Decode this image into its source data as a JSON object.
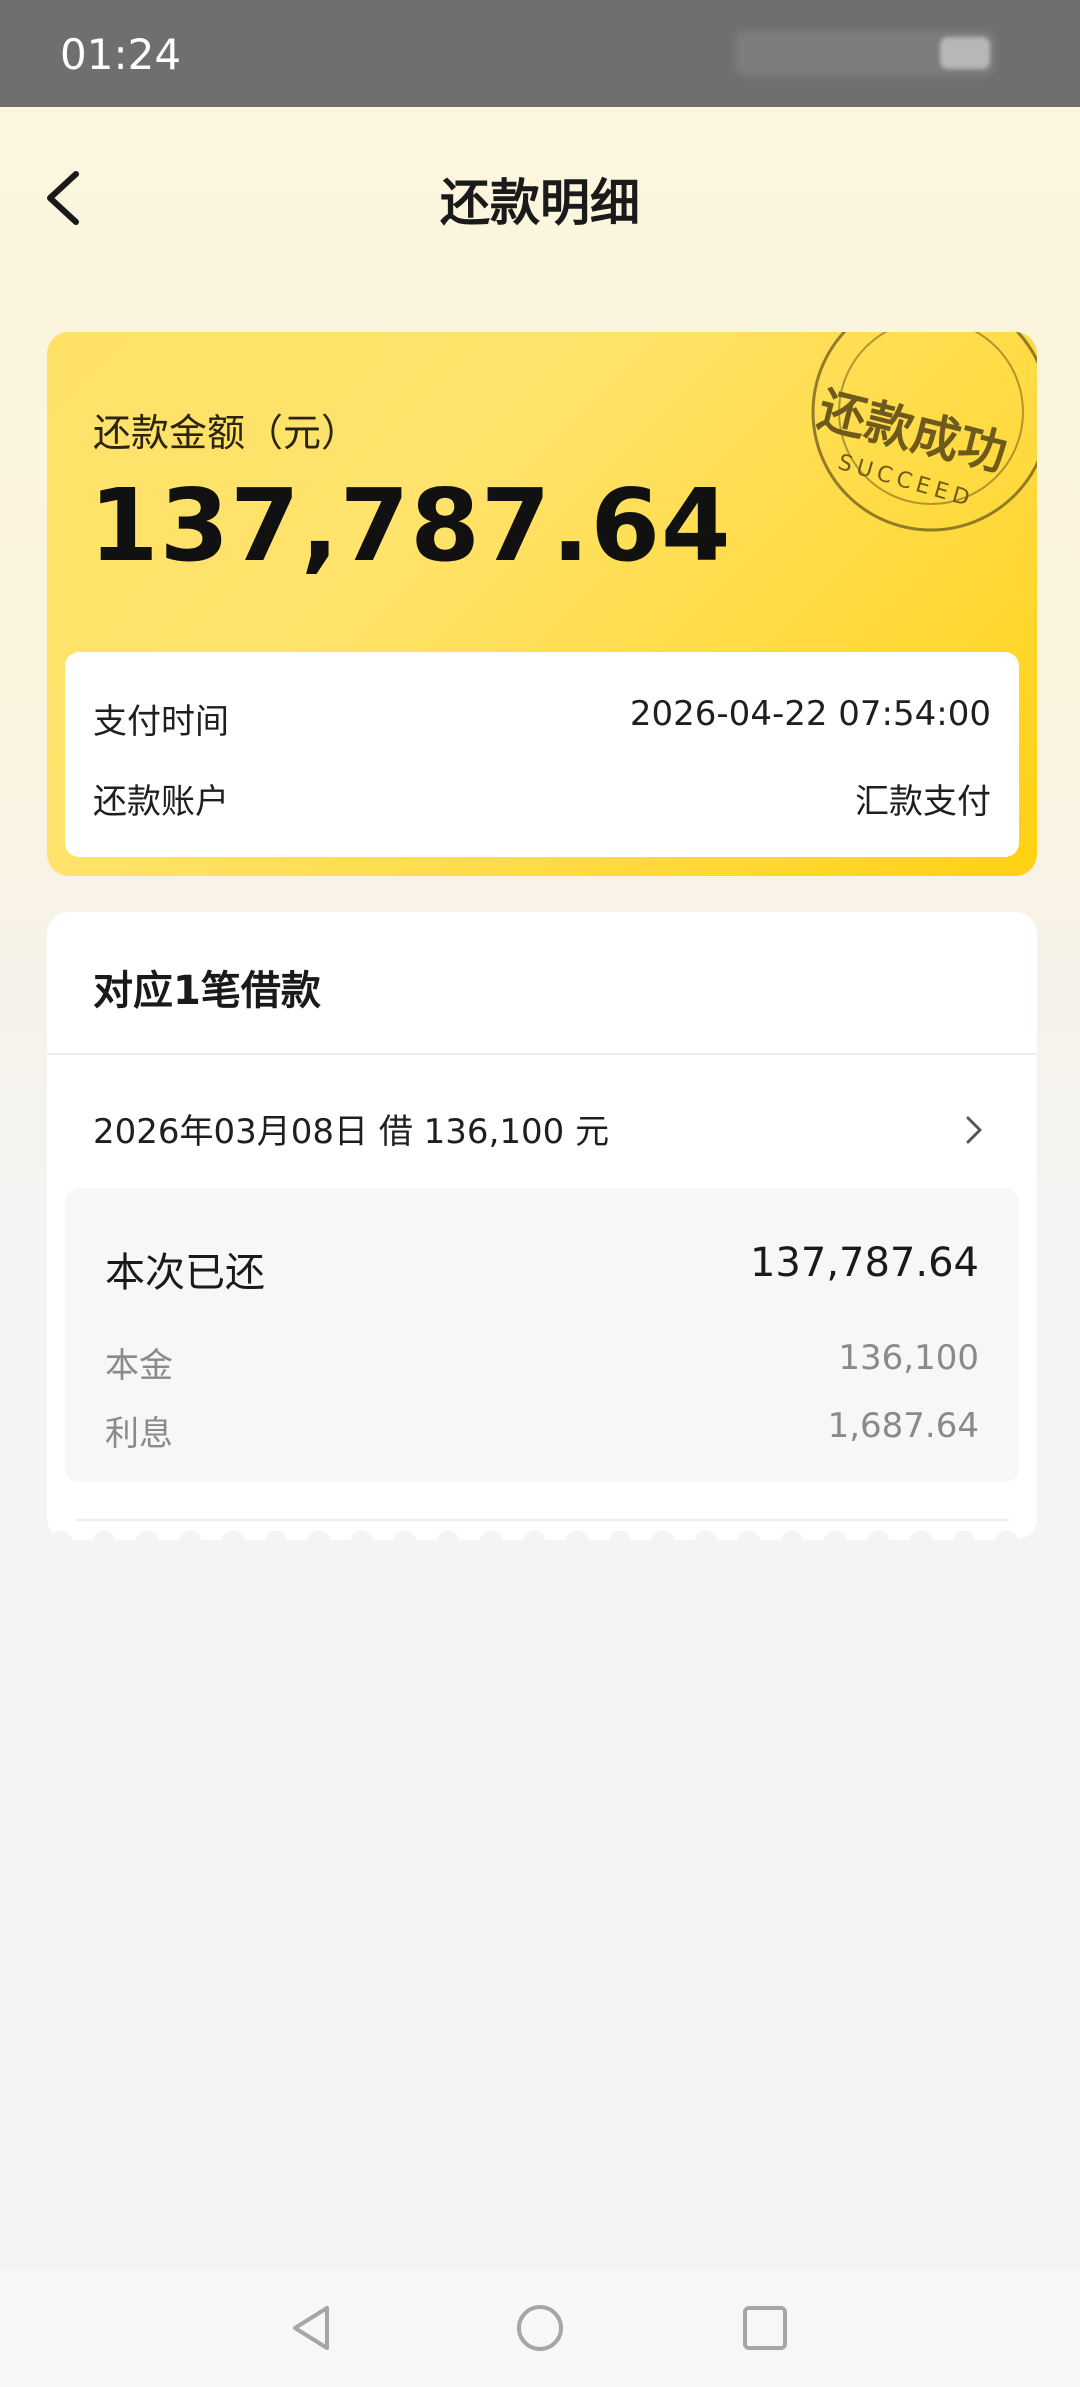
{
  "status_bar": {
    "time": "01:24"
  },
  "header": {
    "title": "还款明细",
    "back_icon": "chevron-left-icon"
  },
  "summary": {
    "amount_label": "还款金额（元）",
    "amount": "137,787.64",
    "stamp": {
      "text": "还款成功",
      "sub": "SUCCEED"
    },
    "rows": [
      {
        "label": "支付时间",
        "value": "2026-04-22 07:54:00"
      },
      {
        "label": "还款账户",
        "value": "汇款支付"
      }
    ]
  },
  "loans": {
    "title": "对应1笔借款",
    "items": [
      {
        "text": "2026年03月08日 借 136,100 元",
        "detail": {
          "title": "本次已还",
          "total": "137,787.64",
          "rows": [
            {
              "label": "本金",
              "value": "136,100"
            },
            {
              "label": "利息",
              "value": "1,687.64"
            }
          ]
        }
      }
    ]
  },
  "system_nav": {
    "icons": [
      "back-triangle-icon",
      "home-circle-icon",
      "recents-square-icon"
    ]
  },
  "colors": {
    "accent_yellow": "#ffd93a",
    "stamp": "#6e5b1c",
    "muted_text": "#8a8a8a"
  }
}
